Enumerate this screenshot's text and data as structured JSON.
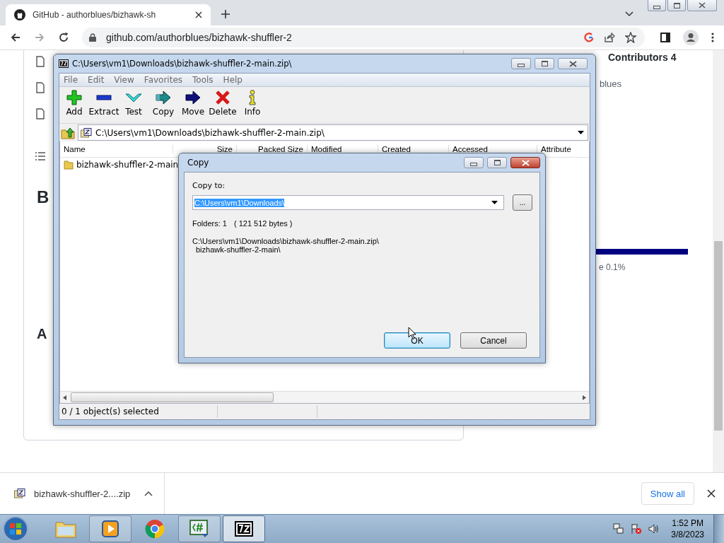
{
  "browser": {
    "tab_title": "GitHub - authorblues/bizhawk-sh",
    "url": "github.com/authorblues/bizhawk-shuffler-2"
  },
  "page": {
    "contributors": "Contributors 4",
    "owner": "blues",
    "heading_1": "B",
    "heading_2": "A",
    "language": "e 0.1%"
  },
  "archive_window": {
    "title": "C:\\Users\\vm1\\Downloads\\bizhawk-shuffler-2-main.zip\\",
    "menu": [
      "File",
      "Edit",
      "View",
      "Favorites",
      "Tools",
      "Help"
    ],
    "toolbar": [
      {
        "label": "Add",
        "kind": "add"
      },
      {
        "label": "Extract",
        "kind": "extract"
      },
      {
        "label": "Test",
        "kind": "test"
      },
      {
        "label": "Copy",
        "kind": "copy"
      },
      {
        "label": "Move",
        "kind": "move"
      },
      {
        "label": "Delete",
        "kind": "delete"
      },
      {
        "label": "Info",
        "kind": "info"
      }
    ],
    "path": "C:\\Users\\vm1\\Downloads\\bizhawk-shuffler-2-main.zip\\",
    "columns": [
      "Name",
      "Size",
      "Packed Size",
      "Modified",
      "Created",
      "Accessed",
      "Attribute"
    ],
    "rows": [
      {
        "name": "bizhawk-shuffler-2-main",
        "selected": false
      }
    ],
    "status": "0 / 1 object(s) selected"
  },
  "copy_dialog": {
    "title": "Copy",
    "label": "Copy to:",
    "value": "C:\\Users\\vm1\\Downloads\\",
    "browse": "...",
    "folders": "Folders: 1",
    "bytes": "( 121 512 bytes )",
    "source": [
      "C:\\Users\\vm1\\Downloads\\bizhawk-shuffler-2-main.zip\\",
      "bizhawk-shuffler-2-main\\"
    ],
    "buttons": [
      {
        "label": "OK",
        "default": true
      },
      {
        "label": "Cancel",
        "default": false
      }
    ]
  },
  "download": {
    "file": "bizhawk-shuffler-2....zip",
    "show_all": "Show all"
  },
  "taskbar": {
    "apps": [
      {
        "kind": "explorer",
        "selected": false
      },
      {
        "kind": "media",
        "selected": false
      },
      {
        "kind": "chrome",
        "selected": false
      },
      {
        "kind": "csharp",
        "selected": false
      },
      {
        "kind": "sevenzip",
        "selected": true
      }
    ],
    "time": "1:52 PM",
    "date": "3/8/2023"
  }
}
